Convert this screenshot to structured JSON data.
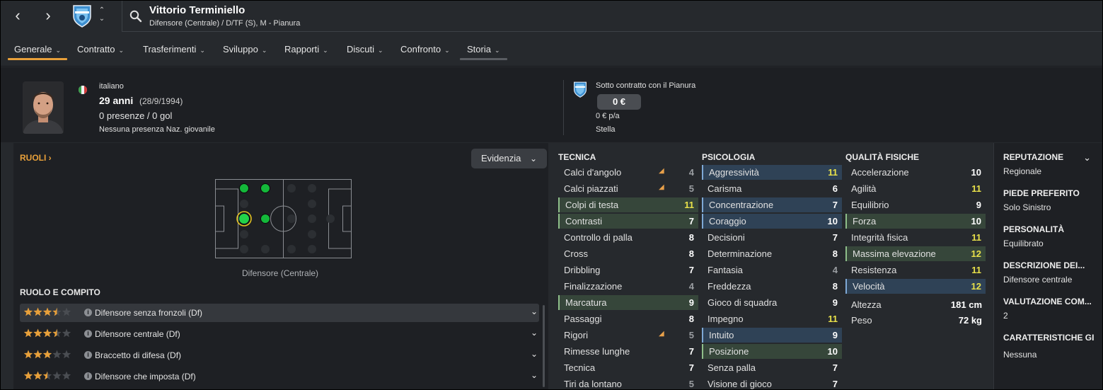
{
  "player": {
    "name": "Vittorio Terminiello",
    "subtitle": "Difensore (Centrale) / D/TF (S), M - Pianura",
    "nationality": "italiano",
    "age": "29 anni",
    "dob": "(28/9/1994)",
    "apps": "0 presenze / 0 gol",
    "youth": "Nessuna presenza Naz. giovanile"
  },
  "contract": {
    "label": "Sotto contratto con il Pianura",
    "value": "0 €",
    "wage": "0 € p/a",
    "status": "Stella"
  },
  "tabs": [
    {
      "label": "Generale"
    },
    {
      "label": "Contratto"
    },
    {
      "label": "Trasferimenti"
    },
    {
      "label": "Sviluppo"
    },
    {
      "label": "Rapporti"
    },
    {
      "label": "Discuti"
    },
    {
      "label": "Confronto"
    },
    {
      "label": "Storia"
    }
  ],
  "colors": {
    "accent": "#e8a03a",
    "green": "#22c55e",
    "yellow_value": "#e8e14a"
  },
  "roles": {
    "title": "RUOLI",
    "highlight_label": "Evidenzia",
    "position_label": "Difensore (Centrale)",
    "list_title": "RUOLO E COMPITO",
    "items": [
      {
        "label": "Difensore senza fronzoli (Df)",
        "stars": 3.5
      },
      {
        "label": "Difensore centrale (Df)",
        "stars": 3.5
      },
      {
        "label": "Braccetto di difesa (Df)",
        "stars": 3
      },
      {
        "label": "Difensore che imposta (Df)",
        "stars": 2.5
      }
    ]
  },
  "tecnica": {
    "title": "TECNICA",
    "items": [
      {
        "name": "Calci d'angolo",
        "value": "4"
      },
      {
        "name": "Calci piazzati",
        "value": "5"
      },
      {
        "name": "Colpi di testa",
        "value": "11"
      },
      {
        "name": "Contrasti",
        "value": "7"
      },
      {
        "name": "Controllo di palla",
        "value": "8"
      },
      {
        "name": "Cross",
        "value": "8"
      },
      {
        "name": "Dribbling",
        "value": "7"
      },
      {
        "name": "Finalizzazione",
        "value": "4"
      },
      {
        "name": "Marcatura",
        "value": "9"
      },
      {
        "name": "Passaggi",
        "value": "8"
      },
      {
        "name": "Rigori",
        "value": "5"
      },
      {
        "name": "Rimesse lunghe",
        "value": "7"
      },
      {
        "name": "Tecnica",
        "value": "7"
      },
      {
        "name": "Tiri da lontano",
        "value": "5"
      }
    ]
  },
  "psicologia": {
    "title": "PSICOLOGIA",
    "items": [
      {
        "name": "Aggressività",
        "value": "11"
      },
      {
        "name": "Carisma",
        "value": "6"
      },
      {
        "name": "Concentrazione",
        "value": "7"
      },
      {
        "name": "Coraggio",
        "value": "10"
      },
      {
        "name": "Decisioni",
        "value": "7"
      },
      {
        "name": "Determinazione",
        "value": "8"
      },
      {
        "name": "Fantasia",
        "value": "4"
      },
      {
        "name": "Freddezza",
        "value": "8"
      },
      {
        "name": "Gioco di squadra",
        "value": "9"
      },
      {
        "name": "Impegno",
        "value": "11"
      },
      {
        "name": "Intuito",
        "value": "9"
      },
      {
        "name": "Posizione",
        "value": "10"
      },
      {
        "name": "Senza palla",
        "value": "7"
      },
      {
        "name": "Visione di gioco",
        "value": "7"
      }
    ]
  },
  "fisico": {
    "title": "QUALITÀ FISICHE",
    "items": [
      {
        "name": "Accelerazione",
        "value": "10"
      },
      {
        "name": "Agilità",
        "value": "11"
      },
      {
        "name": "Equilibrio",
        "value": "9"
      },
      {
        "name": "Forza",
        "value": "10"
      },
      {
        "name": "Integrità fisica",
        "value": "11"
      },
      {
        "name": "Massima elevazione",
        "value": "12"
      },
      {
        "name": "Resistenza",
        "value": "11"
      },
      {
        "name": "Velocità",
        "value": "12"
      }
    ],
    "height_label": "Altezza",
    "height": "181 cm",
    "weight_label": "Peso",
    "weight": "72 kg"
  },
  "side": {
    "reputation_title": "REPUTAZIONE",
    "reputation": "Regionale",
    "foot_title": "PIEDE PREFERITO",
    "foot": "Solo Sinistro",
    "personality_title": "PERSONALITÀ",
    "personality": "Equilibrato",
    "desc_title": "DESCRIZIONE DEI...",
    "desc": "Difensore centrale",
    "rating_title": "VALUTAZIONE COM...",
    "rating": "2",
    "traits_title": "CARATTERISTICHE GI",
    "traits": "Nessuna"
  }
}
